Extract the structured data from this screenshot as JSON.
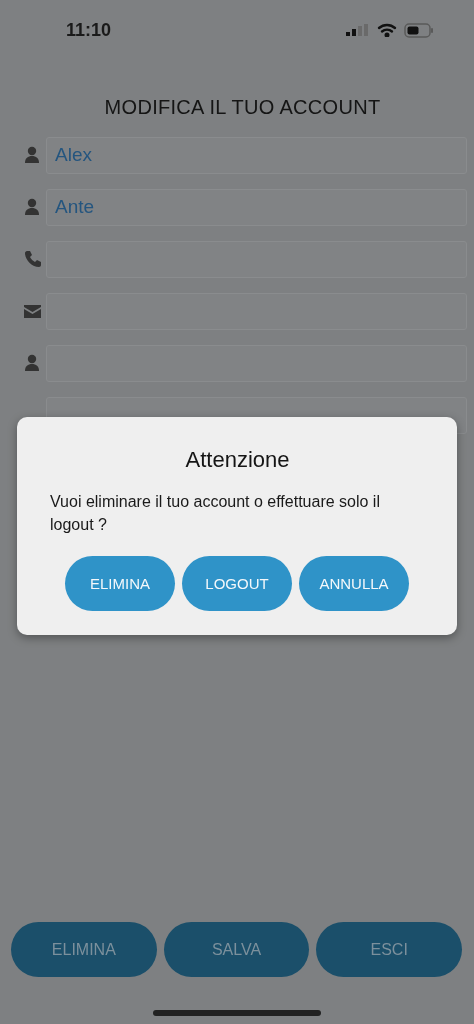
{
  "status_bar": {
    "time": "11:10"
  },
  "title": "MODIFICA IL TUO ACCOUNT",
  "fields": [
    {
      "kind": "person",
      "value": "Alex"
    },
    {
      "kind": "person",
      "value": "Ante"
    },
    {
      "kind": "phone"
    },
    {
      "kind": "mail"
    },
    {
      "kind": "person"
    },
    {
      "kind": "hidden"
    }
  ],
  "dialog": {
    "title": "Attenzione",
    "message": "Vuoi eliminare il tuo account o effettuare solo il logout ?",
    "buttons": [
      "ELIMINA",
      "LOGOUT",
      "ANNULLA"
    ]
  },
  "bottom_buttons": [
    "ELIMINA",
    "SALVA",
    "ESCI"
  ]
}
